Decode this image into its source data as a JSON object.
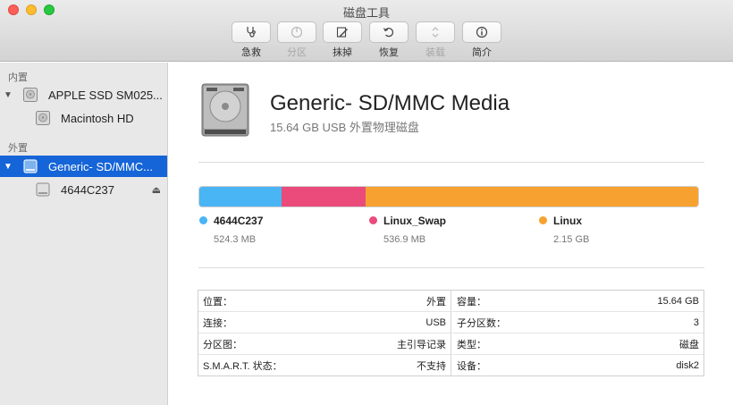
{
  "window": {
    "title": "磁盘工具"
  },
  "toolbar": {
    "items": [
      {
        "label": "急救",
        "icon": "stethoscope-icon",
        "enabled": true
      },
      {
        "label": "分区",
        "icon": "partition-icon",
        "enabled": false
      },
      {
        "label": "抹掉",
        "icon": "erase-icon",
        "enabled": true
      },
      {
        "label": "恢复",
        "icon": "restore-icon",
        "enabled": true
      },
      {
        "label": "装载",
        "icon": "mount-icon",
        "enabled": false
      },
      {
        "label": "简介",
        "icon": "info-icon",
        "enabled": true
      }
    ]
  },
  "sidebar": {
    "internal_header": "内置",
    "external_header": "外置",
    "items": [
      {
        "name": "APPLE SSD SM025...",
        "icon": "internal-disk-icon",
        "expanded": true
      },
      {
        "name": "Macintosh HD",
        "icon": "volume-icon"
      },
      {
        "name": "Generic- SD/MMC...",
        "icon": "external-disk-icon",
        "expanded": true,
        "selected": true
      },
      {
        "name": "4644C237",
        "icon": "volume-icon",
        "eject": "⏏"
      }
    ]
  },
  "disk": {
    "name": "Generic- SD/MMC Media",
    "subtitle": "15.64 GB USB 外置物理磁盘"
  },
  "partitions": [
    {
      "name": "4644C237",
      "size": "524.3 MB",
      "color": "#49b5f5",
      "fraction": 0.165
    },
    {
      "name": "Linux_Swap",
      "size": "536.9 MB",
      "color": "#ea4b7b",
      "fraction": 0.168
    },
    {
      "name": "Linux",
      "size": "2.15 GB",
      "color": "#f7a230",
      "fraction": 0.667
    }
  ],
  "info": {
    "left": [
      {
        "label": "位置：",
        "value": "外置"
      },
      {
        "label": "连接：",
        "value": "USB"
      },
      {
        "label": "分区图：",
        "value": "主引导记录"
      },
      {
        "label": "S.M.A.R.T. 状态：",
        "value": "不支持"
      }
    ],
    "right": [
      {
        "label": "容量：",
        "value": "15.64 GB"
      },
      {
        "label": "子分区数：",
        "value": "3"
      },
      {
        "label": "类型：",
        "value": "磁盘"
      },
      {
        "label": "设备：",
        "value": "disk2"
      }
    ]
  }
}
